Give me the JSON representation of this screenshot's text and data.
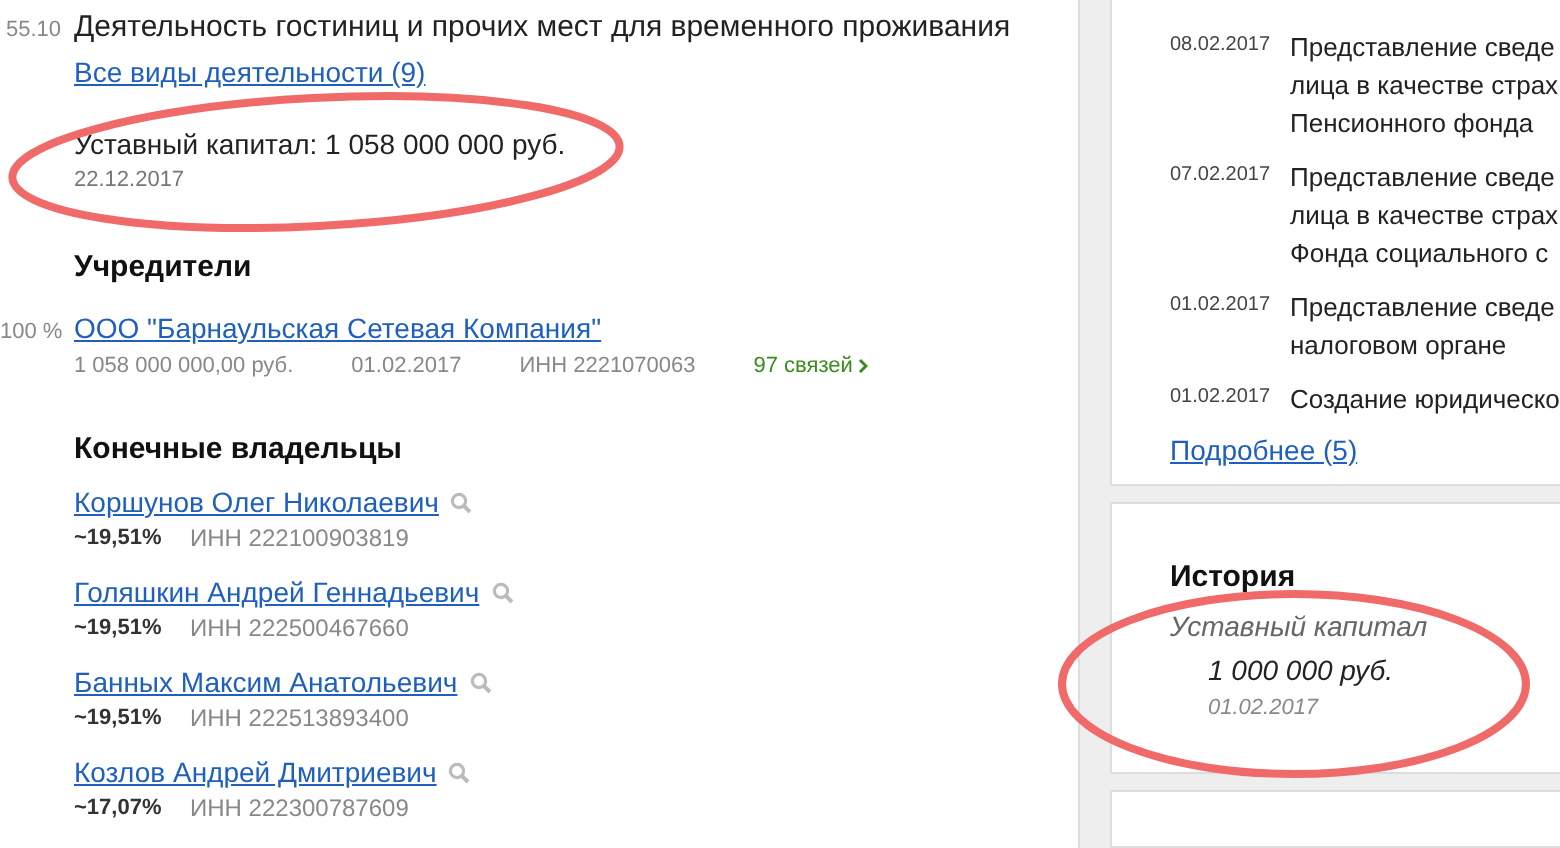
{
  "activity": {
    "code": "55.10",
    "name": "Деятельность гостиниц и прочих мест для временного проживания",
    "all_link": "Все виды деятельности (9)"
  },
  "capital": {
    "text": "Уставный капитал: 1 058 000 000 руб.",
    "date": "22.12.2017"
  },
  "founders": {
    "title": "Учредители",
    "items": [
      {
        "share": "100 %",
        "name": "ООО \"Барнаульская Сетевая Компания\"",
        "amount": "1 058 000 000,00 руб.",
        "date": "01.02.2017",
        "inn": "ИНН 2221070063",
        "links": "97 связей"
      }
    ]
  },
  "owners": {
    "title": "Конечные владельцы",
    "items": [
      {
        "name": "Коршунов Олег Николаевич",
        "share": "~19,51%",
        "inn": "ИНН 222100903819"
      },
      {
        "name": "Голяшкин Андрей Геннадьевич",
        "share": "~19,51%",
        "inn": "ИНН 222500467660"
      },
      {
        "name": "Банных Максим Анатольевич",
        "share": "~19,51%",
        "inn": "ИНН 222513893400"
      },
      {
        "name": "Козлов Андрей Дмитриевич",
        "share": "~17,07%",
        "inn": "ИНН 222300787609"
      }
    ]
  },
  "events": {
    "items": [
      {
        "date": "08.02.2017",
        "lines": [
          "Представление сведе",
          "лица в качестве страх",
          "Пенсионного фонда"
        ]
      },
      {
        "date": "07.02.2017",
        "lines": [
          "Представление сведе",
          "лица в качестве страх",
          "Фонда социального с"
        ]
      },
      {
        "date": "01.02.2017",
        "lines": [
          "Представление сведе",
          "налоговом органе"
        ]
      },
      {
        "date": "01.02.2017",
        "lines": [
          "Создание юридическо"
        ]
      }
    ],
    "more_link": "Подробнее (5)"
  },
  "history": {
    "title": "История",
    "label": "Уставный капитал",
    "value": "1 000 000 руб.",
    "date": "01.02.2017"
  }
}
